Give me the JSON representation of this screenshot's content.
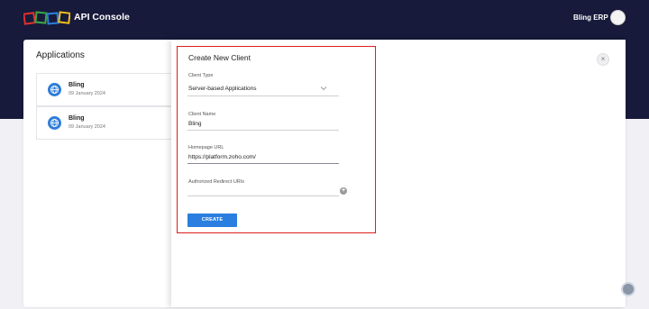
{
  "header": {
    "app_title": "API Console",
    "user_name": "Bling ERP"
  },
  "applications": {
    "heading": "Applications",
    "items": [
      {
        "name": "Bling",
        "date": "09 January 2024"
      },
      {
        "name": "Bling",
        "date": "09 January 2024"
      }
    ]
  },
  "form": {
    "title": "Create New Client",
    "client_type": {
      "label": "Client Type",
      "value": "Server-based Applications"
    },
    "client_name": {
      "label": "Client Name",
      "value": "Bling"
    },
    "homepage_url": {
      "label": "Homepage URL",
      "value": "https://platform.zoho.com/"
    },
    "redirect_uris": {
      "label": "Authorized Redirect URIs",
      "value": ""
    },
    "create_label": "CREATE"
  },
  "icons": {
    "logo": "zoho-logo",
    "app": "globe-icon",
    "close": "close-icon",
    "add": "plus-circle-icon",
    "dropdown": "chevron-down-icon",
    "help": "help-icon"
  },
  "colors": {
    "header_bg": "#171a3a",
    "accent": "#2a7ee0",
    "highlight": "#e11d1d"
  }
}
